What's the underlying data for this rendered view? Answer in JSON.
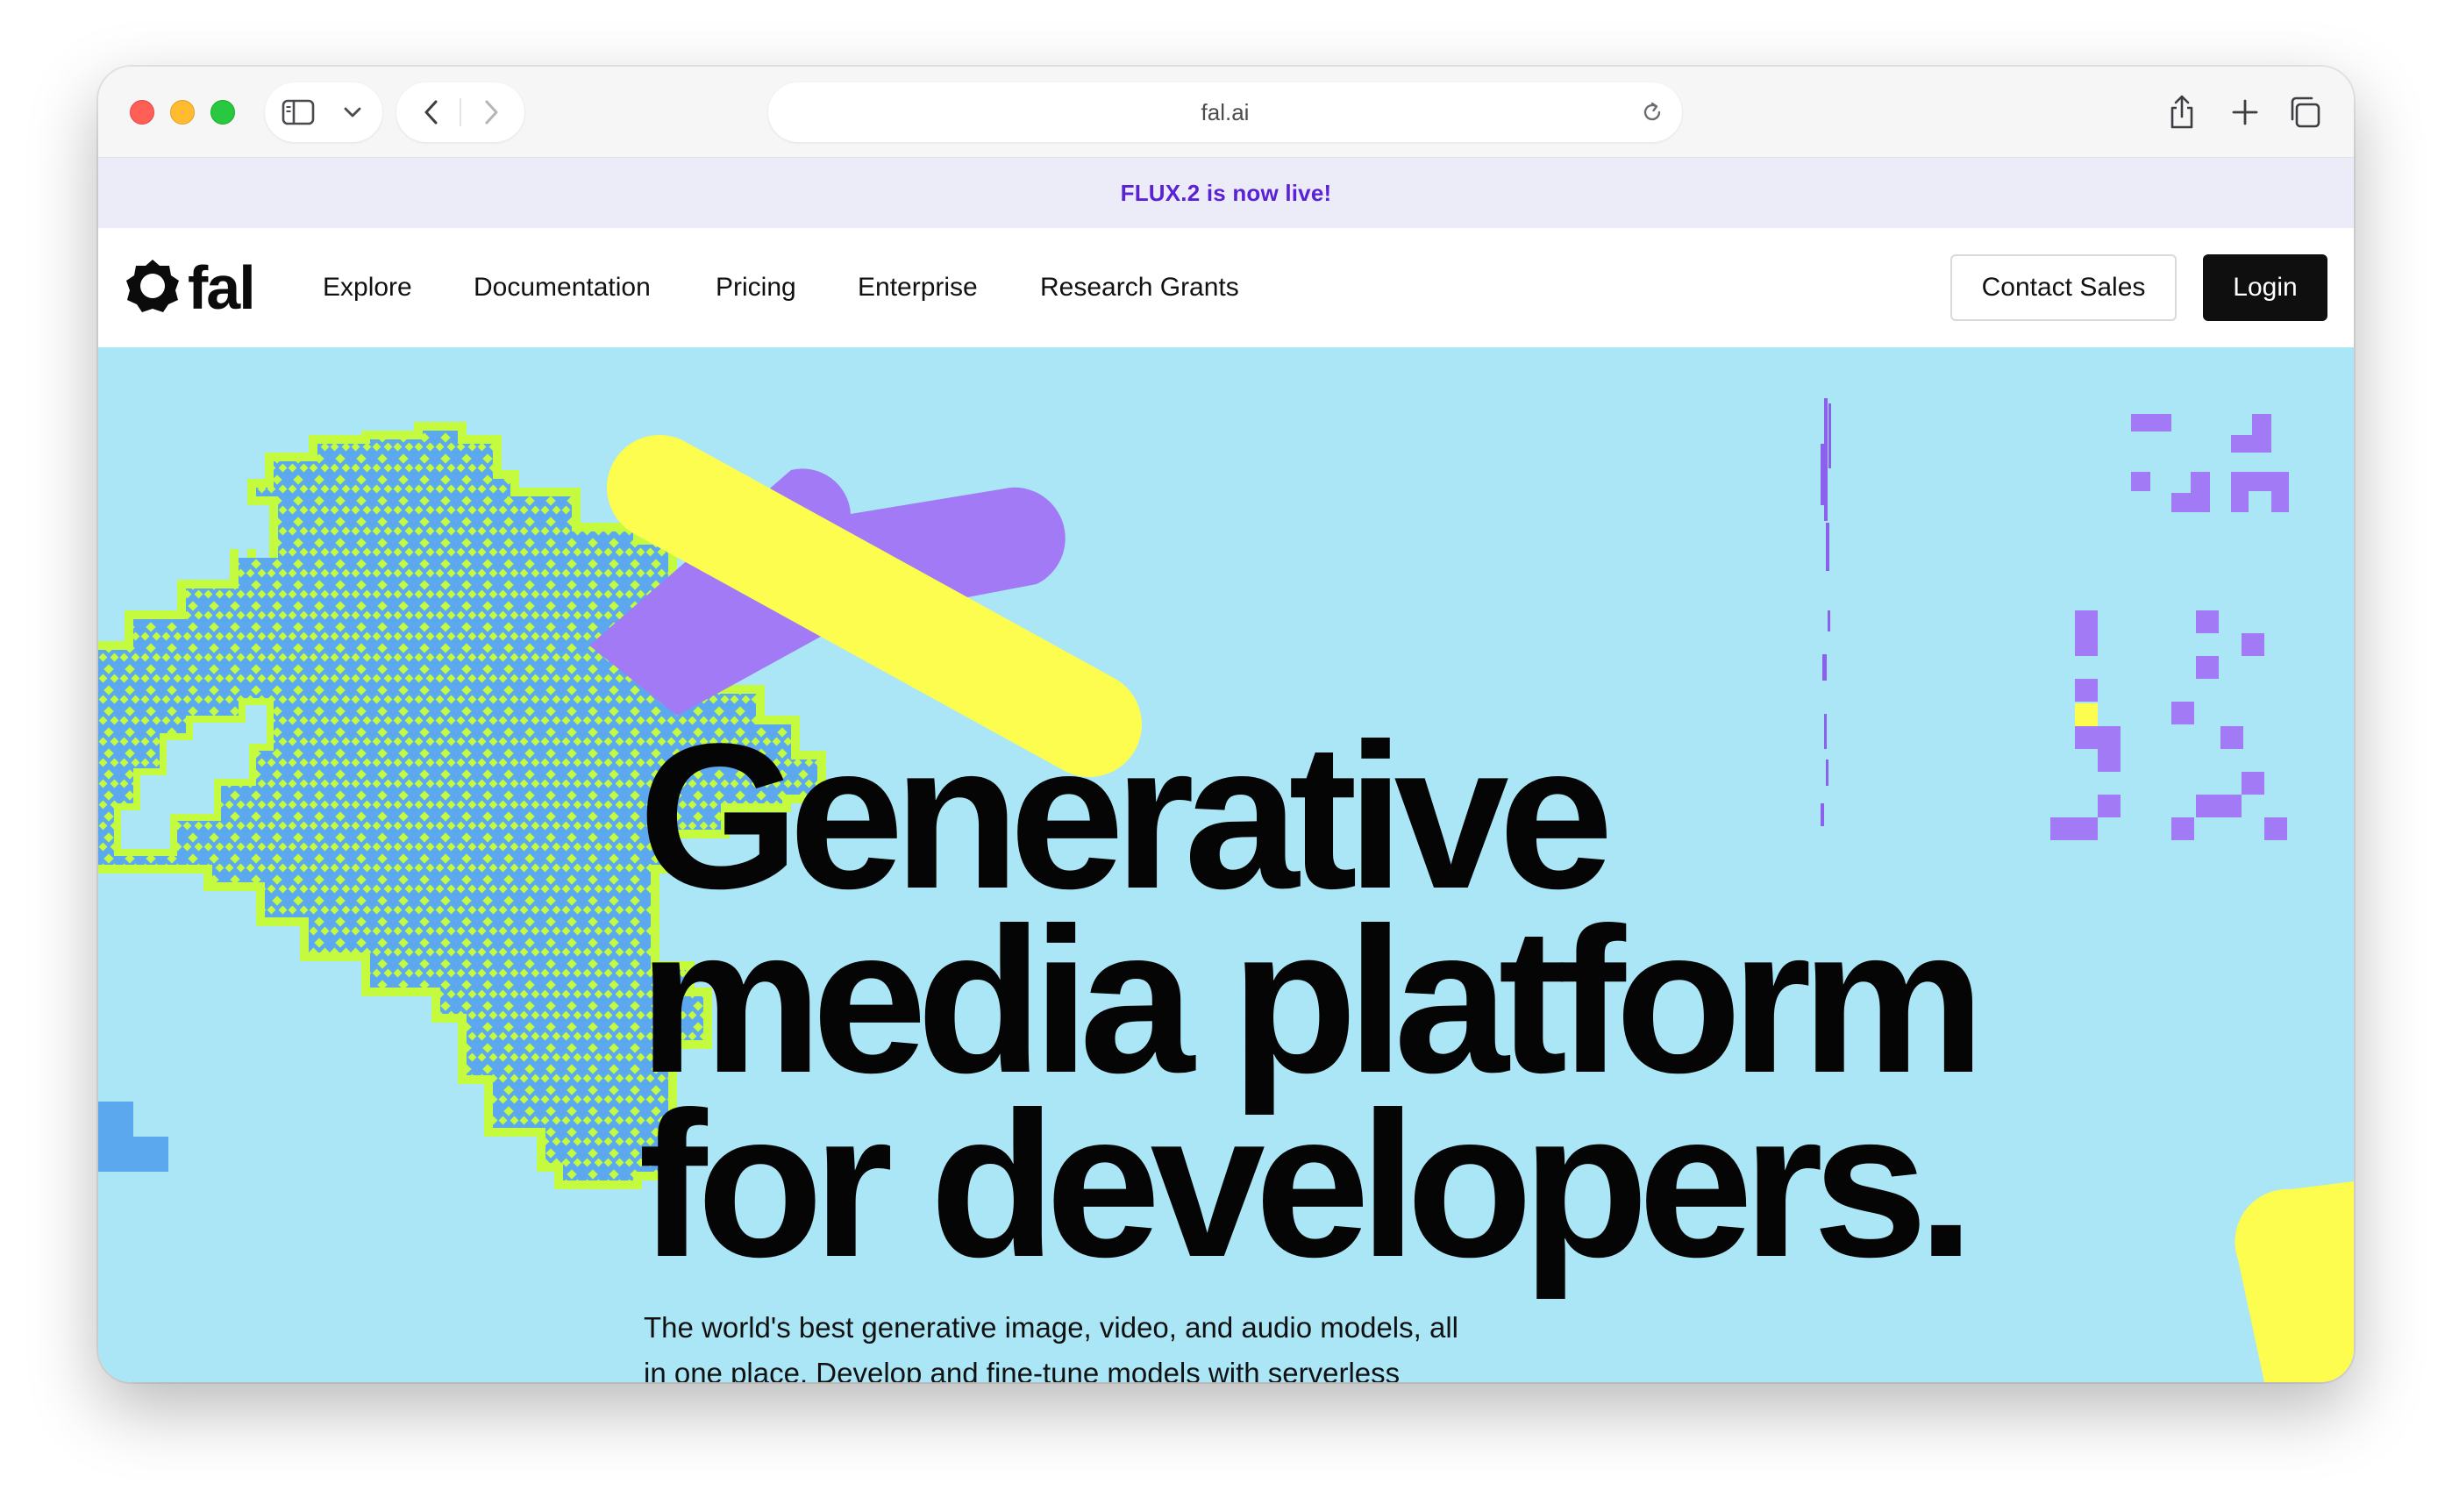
{
  "browser": {
    "url": "fal.ai"
  },
  "announcement": {
    "text": "FLUX.2 is now live!"
  },
  "nav": {
    "logo_text": "fal",
    "links": [
      "Explore",
      "Documentation",
      "Pricing",
      "Enterprise",
      "Research Grants"
    ],
    "contact_label": "Contact Sales",
    "login_label": "Login"
  },
  "hero": {
    "headline_lines": [
      "Generative",
      "media platform",
      "for developers."
    ],
    "subtitle": "The world's best generative image, video, and audio models, all in one place. Develop and fine-tune models with serverless"
  },
  "colors": {
    "hero_bg": "#abe6f6",
    "accent_purple": "#a27af5",
    "accent_yellow": "#fdfd4f",
    "blob_blue": "#5ba8ef",
    "blob_lime": "#c5fb3f",
    "announce_text": "#5b21d6"
  },
  "icons": {
    "sidebar": "sidebar-icon",
    "chevron": "chevron-down-icon",
    "back": "back-arrow-icon",
    "forward": "forward-arrow-icon",
    "reload": "reload-icon",
    "share": "share-icon",
    "new_tab": "plus-icon",
    "tabs": "tabs-overview-icon",
    "logo": "fal-logo-icon"
  }
}
